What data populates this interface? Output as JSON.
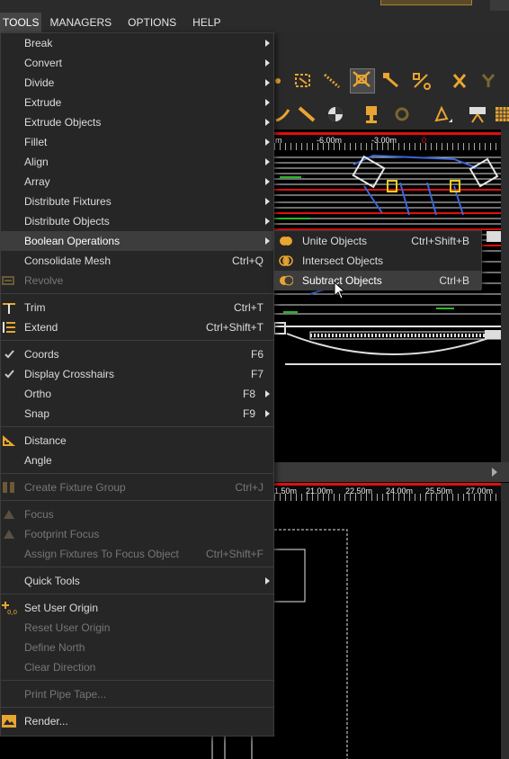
{
  "menubar": {
    "items": [
      {
        "label": "TOOLS",
        "active": true
      },
      {
        "label": "MANAGERS",
        "active": false
      },
      {
        "label": "OPTIONS",
        "active": false
      },
      {
        "label": "HELP",
        "active": false
      }
    ]
  },
  "tools_menu": {
    "items": [
      {
        "label": "Break",
        "shortcut": "",
        "submenu": true
      },
      {
        "label": "Convert",
        "shortcut": "",
        "submenu": true
      },
      {
        "label": "Divide",
        "shortcut": "",
        "submenu": true
      },
      {
        "label": "Extrude",
        "shortcut": "",
        "submenu": true
      },
      {
        "label": "Extrude Objects",
        "shortcut": "",
        "submenu": true
      },
      {
        "label": "Fillet",
        "shortcut": "",
        "submenu": true
      },
      {
        "label": "Align",
        "shortcut": "",
        "submenu": true
      },
      {
        "label": "Array",
        "shortcut": "",
        "submenu": true
      },
      {
        "label": "Distribute Fixtures",
        "shortcut": "",
        "submenu": true
      },
      {
        "label": "Distribute Objects",
        "shortcut": "",
        "submenu": true
      },
      {
        "label": "Boolean Operations",
        "shortcut": "",
        "submenu": true,
        "highlighted": true
      },
      {
        "label": "Consolidate Mesh",
        "shortcut": "Ctrl+Q"
      },
      {
        "label": "Revolve",
        "shortcut": "",
        "disabled": true,
        "icon": "revolve-icon"
      },
      {
        "label": "Trim",
        "shortcut": "Ctrl+T",
        "icon": "trim-icon"
      },
      {
        "label": "Extend",
        "shortcut": "Ctrl+Shift+T",
        "icon": "extend-icon"
      },
      {
        "label": "Coords",
        "shortcut": "F6",
        "icon": "checkmark-icon",
        "checked": true
      },
      {
        "label": "Display Crosshairs",
        "shortcut": "F7",
        "icon": "checkmark-icon",
        "checked": true
      },
      {
        "label": "Ortho",
        "shortcut": "F8",
        "submenu": true
      },
      {
        "label": "Snap",
        "shortcut": "F9",
        "submenu": true
      },
      {
        "label": "Distance",
        "shortcut": "",
        "icon": "distance-icon"
      },
      {
        "label": "Angle",
        "shortcut": ""
      },
      {
        "label": "Create Fixture Group",
        "shortcut": "Ctrl+J",
        "disabled": true,
        "icon": "fixture-group-icon"
      },
      {
        "label": "Focus",
        "shortcut": "",
        "disabled": true,
        "icon": "focus-icon"
      },
      {
        "label": "Footprint Focus",
        "shortcut": "",
        "disabled": true,
        "icon": "footprint-focus-icon"
      },
      {
        "label": "Assign Fixtures To Focus Object",
        "shortcut": "Ctrl+Shift+F",
        "disabled": true
      },
      {
        "label": "Quick Tools",
        "shortcut": "",
        "submenu": true
      },
      {
        "label": "Set User Origin",
        "shortcut": "",
        "icon": "user-origin-icon"
      },
      {
        "label": "Reset User Origin",
        "shortcut": "",
        "disabled": true
      },
      {
        "label": "Define North",
        "shortcut": "",
        "disabled": true
      },
      {
        "label": "Clear Direction",
        "shortcut": "",
        "disabled": true
      },
      {
        "label": "Print Pipe Tape...",
        "shortcut": "",
        "disabled": true
      },
      {
        "label": "Render...",
        "shortcut": "",
        "icon": "render-icon"
      }
    ]
  },
  "boolean_submenu": {
    "items": [
      {
        "label": "Unite Objects",
        "shortcut": "Ctrl+Shift+B",
        "icon": "unite-icon"
      },
      {
        "label": "Intersect Objects",
        "shortcut": "",
        "icon": "intersect-icon"
      },
      {
        "label": "Subtract Objects",
        "shortcut": "Ctrl+B",
        "icon": "subtract-icon",
        "highlighted": true
      }
    ]
  },
  "rulers": {
    "top": [
      "-6.00m",
      "-3.00m",
      "0"
    ],
    "bottom": [
      "1.50m",
      "21.00m",
      "22.50m",
      "24.00m",
      "25.50m",
      "27.00m"
    ]
  },
  "colors": {
    "accent": "#e8a530",
    "menu_bg": "#262626",
    "highlight": "#3d3d3d",
    "ruler_red": "#e01010"
  }
}
